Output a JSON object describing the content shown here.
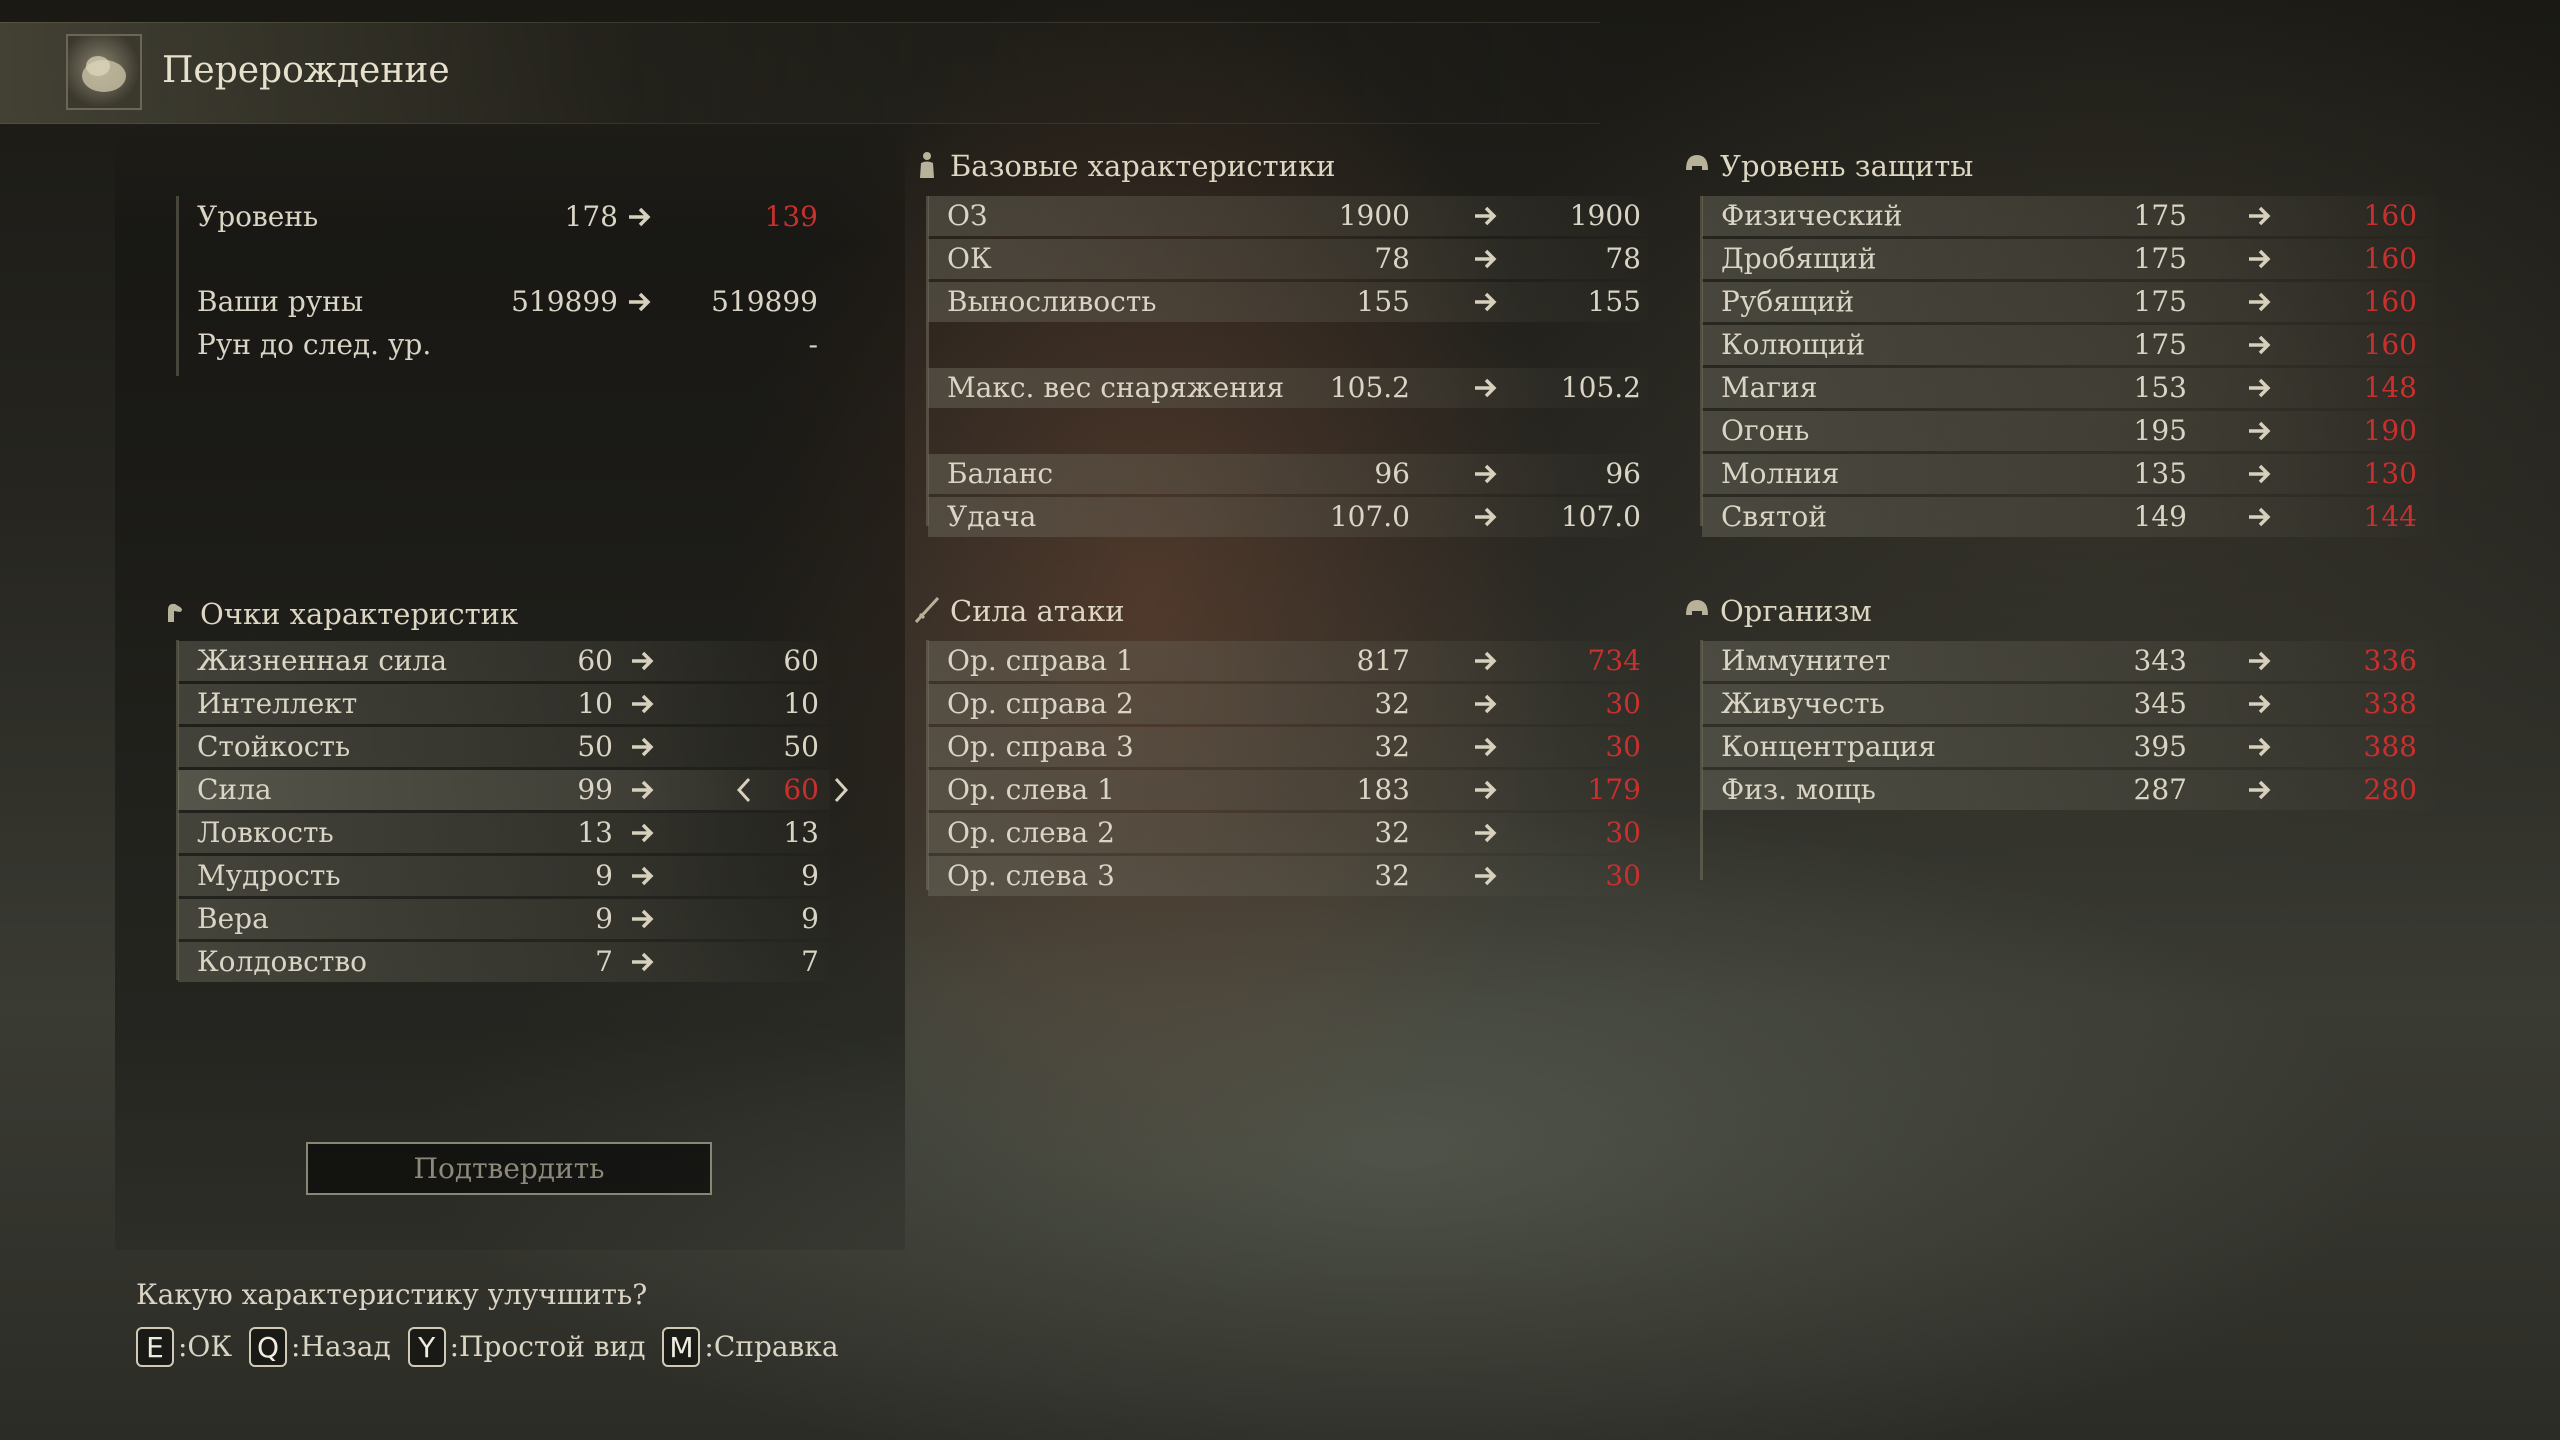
{
  "title": "Перерождение",
  "level": {
    "label": "Уровень",
    "current": "178",
    "new": "139"
  },
  "runes": {
    "label": "Ваши руны",
    "current": "519899",
    "new": "519899"
  },
  "runes_next": {
    "label": "Рун до след. ур.",
    "value": "-"
  },
  "attributes": {
    "heading": "Очки характеристик",
    "rows": [
      {
        "label": "Жизненная сила",
        "current": "60",
        "new": "60"
      },
      {
        "label": "Интеллект",
        "current": "10",
        "new": "10"
      },
      {
        "label": "Стойкость",
        "current": "50",
        "new": "50"
      },
      {
        "label": "Сила",
        "current": "99",
        "new": "60"
      },
      {
        "label": "Ловкость",
        "current": "13",
        "new": "13"
      },
      {
        "label": "Мудрость",
        "current": "9",
        "new": "9"
      },
      {
        "label": "Вера",
        "current": "9",
        "new": "9"
      },
      {
        "label": "Колдовство",
        "current": "7",
        "new": "7"
      }
    ]
  },
  "base_stats": {
    "heading": "Базовые характеристики",
    "rows": [
      {
        "label": "ОЗ",
        "current": "1900",
        "new": "1900"
      },
      {
        "label": "ОК",
        "current": "78",
        "new": "78"
      },
      {
        "label": "Выносливость",
        "current": "155",
        "new": "155"
      },
      {
        "label": "Макс. вес снаряжения",
        "current": "105.2",
        "new": "105.2"
      },
      {
        "label": "Баланс",
        "current": "96",
        "new": "96"
      },
      {
        "label": "Удача",
        "current": "107.0",
        "new": "107.0"
      }
    ]
  },
  "attack": {
    "heading": "Сила атаки",
    "rows": [
      {
        "label": "Ор. справа 1",
        "current": "817",
        "new": "734"
      },
      {
        "label": "Ор. справа 2",
        "current": "32",
        "new": "30"
      },
      {
        "label": "Ор. справа 3",
        "current": "32",
        "new": "30"
      },
      {
        "label": "Ор. слева 1",
        "current": "183",
        "new": "179"
      },
      {
        "label": "Ор. слева 2",
        "current": "32",
        "new": "30"
      },
      {
        "label": "Ор. слева 3",
        "current": "32",
        "new": "30"
      }
    ]
  },
  "defense": {
    "heading": "Уровень защиты",
    "rows": [
      {
        "label": "Физический",
        "current": "175",
        "new": "160"
      },
      {
        "label": "Дробящий",
        "current": "175",
        "new": "160"
      },
      {
        "label": "Рубящий",
        "current": "175",
        "new": "160"
      },
      {
        "label": "Колющий",
        "current": "175",
        "new": "160"
      },
      {
        "label": "Магия",
        "current": "153",
        "new": "148"
      },
      {
        "label": "Огонь",
        "current": "195",
        "new": "190"
      },
      {
        "label": "Молния",
        "current": "135",
        "new": "130"
      },
      {
        "label": "Святой",
        "current": "149",
        "new": "144"
      }
    ]
  },
  "resist": {
    "heading": "Организм",
    "rows": [
      {
        "label": "Иммунитет",
        "current": "343",
        "new": "336"
      },
      {
        "label": "Живучесть",
        "current": "345",
        "new": "338"
      },
      {
        "label": "Концентрация",
        "current": "395",
        "new": "388"
      },
      {
        "label": "Физ. мощь",
        "current": "287",
        "new": "280"
      }
    ]
  },
  "confirm_label": "Подтвердить",
  "prompt": "Какую характеристику улучшить?",
  "hints": [
    {
      "key": "E",
      "label": ":ОК"
    },
    {
      "key": "Q",
      "label": ":Назад"
    },
    {
      "key": "Y",
      "label": ":Простой вид"
    },
    {
      "key": "M",
      "label": ":Справка"
    }
  ],
  "colors": {
    "decreased": "#c8302e",
    "text": "#d9d4c4",
    "arrow": "#d6d0bd"
  },
  "icons": {
    "title": "rebirth-icon",
    "base": "figure-icon",
    "attack": "sword-icon",
    "defense": "helmet-icon",
    "resist": "helmet-icon",
    "attributes": "arm-icon",
    "arrow": "arrow-right-icon",
    "prev": "chevron-left-icon",
    "next": "chevron-right-icon"
  }
}
